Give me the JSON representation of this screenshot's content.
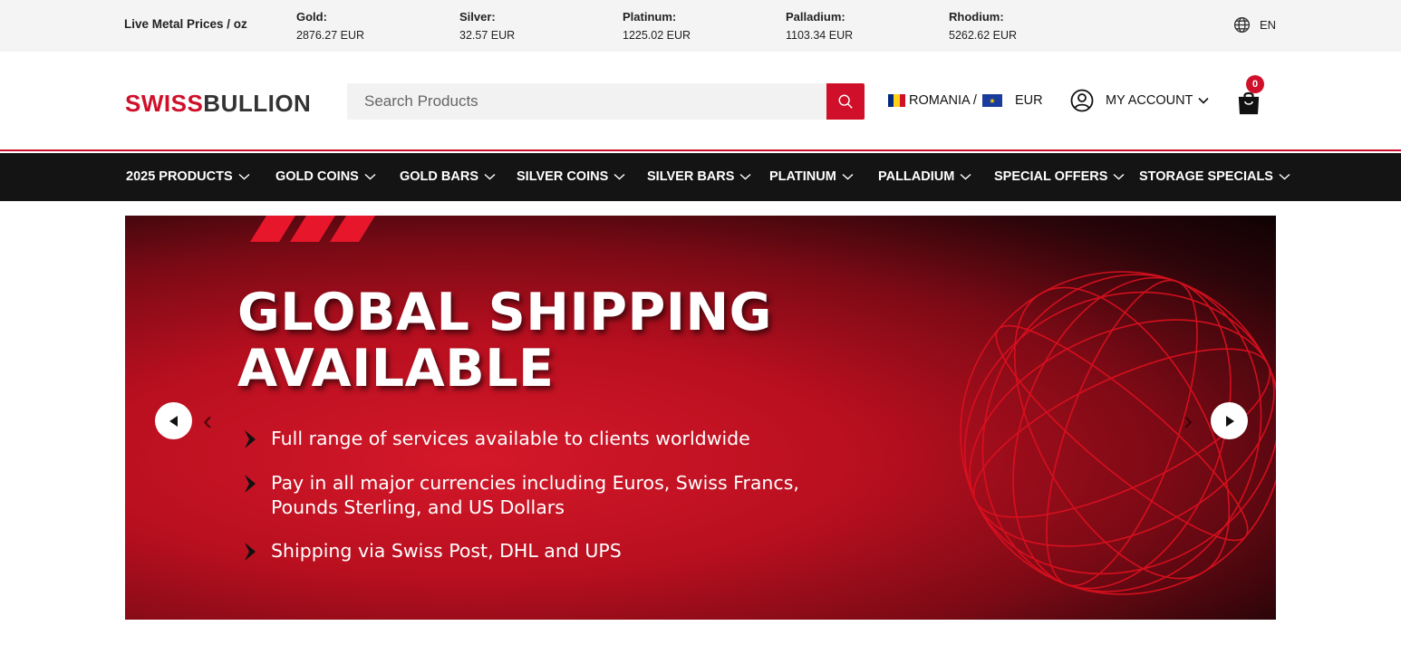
{
  "ticker": {
    "title": "Live Metal Prices / oz",
    "metals": [
      {
        "name": "Gold:",
        "price": "2876.27 EUR"
      },
      {
        "name": "Silver:",
        "price": "32.57 EUR"
      },
      {
        "name": "Platinum:",
        "price": "1225.02 EUR"
      },
      {
        "name": "Palladium:",
        "price": "1103.34 EUR"
      },
      {
        "name": "Rhodium:",
        "price": "5262.62 EUR"
      }
    ],
    "language": "EN",
    "language_icon": "globe-icon"
  },
  "header": {
    "logo_part1": "SWISS",
    "logo_part2": "BULLION",
    "search_placeholder": "Search Products",
    "country": "ROMANIA /",
    "currency": "EUR",
    "account_label": "MY ACCOUNT",
    "cart_count": "0",
    "brand_color": "#d0102a"
  },
  "nav": {
    "items": [
      {
        "label": "2025 PRODUCTS"
      },
      {
        "label": "GOLD COINS"
      },
      {
        "label": "GOLD BARS"
      },
      {
        "label": "SILVER COINS"
      },
      {
        "label": "SILVER BARS"
      },
      {
        "label": "PLATINUM"
      },
      {
        "label": "PALLADIUM"
      },
      {
        "label": "SPECIAL OFFERS"
      },
      {
        "label": "STORAGE SPECIALS"
      }
    ]
  },
  "banner": {
    "headline_line1": "GLOBAL SHIPPING",
    "headline_line2": "AVAILABLE",
    "bullets": [
      {
        "line1": "Full range of services available to clients worldwide",
        "line2": ""
      },
      {
        "line1": "Pay in all major currencies including Euros, Swiss Francs,",
        "line2": "Pounds Sterling, and US Dollars"
      },
      {
        "line1": "Shipping via Swiss Post, DHL and UPS",
        "line2": ""
      }
    ]
  }
}
